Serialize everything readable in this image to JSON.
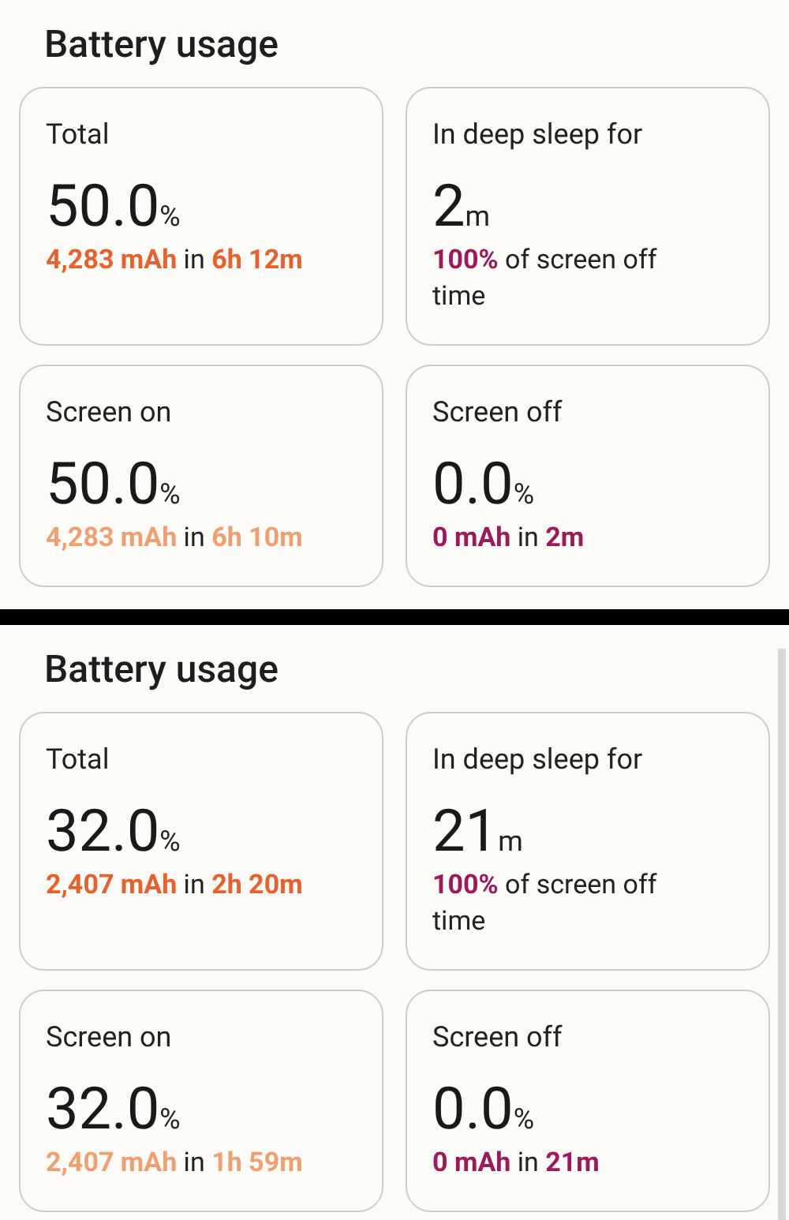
{
  "panels": [
    {
      "title": "Battery usage",
      "scrollbar": false,
      "cards": [
        {
          "label": "Total",
          "value": "50.0",
          "unit": "%",
          "color": "#e8602c",
          "detail": "**4,283 mAh** in **6h 12m**"
        },
        {
          "label": "In deep sleep for",
          "value": "2",
          "unit": "m",
          "color": "#9c1a5a",
          "detail": "**100%** of screen off time"
        },
        {
          "label": "Screen on",
          "value": "50.0",
          "unit": "%",
          "color": "#f0a070",
          "detail": "**4,283 mAh** in **6h 10m**"
        },
        {
          "label": "Screen off",
          "value": "0.0",
          "unit": "%",
          "color": "#9c1a5a",
          "detail": "**0 mAh** in **2m**"
        }
      ]
    },
    {
      "title": "Battery usage",
      "scrollbar": true,
      "cards": [
        {
          "label": "Total",
          "value": "32.0",
          "unit": "%",
          "color": "#e8602c",
          "detail": "**2,407 mAh** in **2h 20m**"
        },
        {
          "label": "In deep sleep for",
          "value": "21",
          "unit": "m",
          "color": "#9c1a5a",
          "detail": "**100%** of screen off time"
        },
        {
          "label": "Screen on",
          "value": "32.0",
          "unit": "%",
          "color": "#f0a070",
          "detail": "**2,407 mAh** in **1h 59m**"
        },
        {
          "label": "Screen off",
          "value": "0.0",
          "unit": "%",
          "color": "#9c1a5a",
          "detail": "**0 mAh** in **21m**"
        }
      ]
    }
  ]
}
